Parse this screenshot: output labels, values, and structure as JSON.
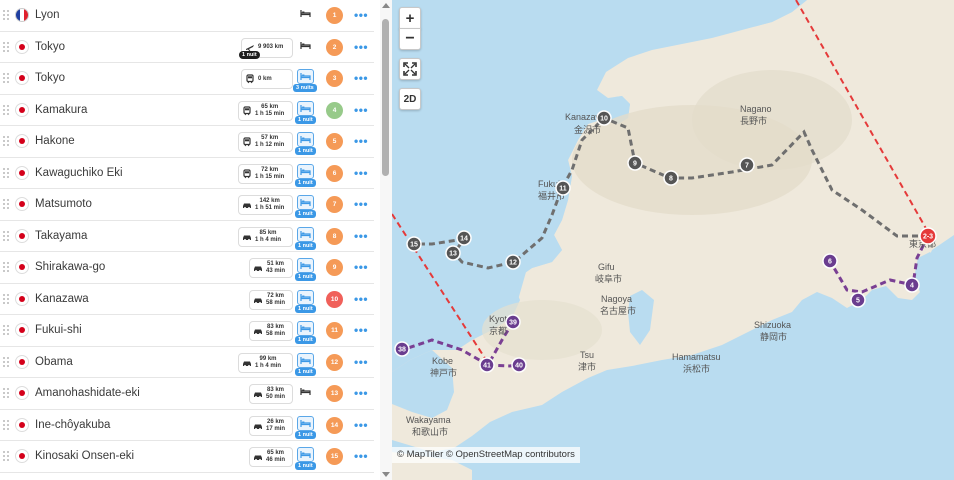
{
  "itinerary": [
    {
      "city": "Lyon",
      "flag": "fr",
      "number": "1",
      "color": "#f59a57",
      "stay": "home"
    },
    {
      "city": "Tokyo",
      "flag": "jp",
      "number": "2",
      "color": "#f59a57",
      "stay": "home",
      "transport": {
        "mode": "plane",
        "distance": "9 903 km",
        "duration": ""
      },
      "transport_badge": "1 nuit"
    },
    {
      "city": "Tokyo",
      "flag": "jp",
      "number": "3",
      "color": "#f59a57",
      "stay": "book",
      "nights": "3 nuits",
      "transport": {
        "mode": "train",
        "distance": "0 km",
        "duration": ""
      }
    },
    {
      "city": "Kamakura",
      "flag": "jp",
      "number": "4",
      "color": "#97ca8a",
      "stay": "book",
      "nights": "1 nuit",
      "transport": {
        "mode": "train",
        "distance": "65 km",
        "duration": "1 h 15 min"
      }
    },
    {
      "city": "Hakone",
      "flag": "jp",
      "number": "5",
      "color": "#f59a57",
      "stay": "book",
      "nights": "1 nuit",
      "transport": {
        "mode": "train",
        "distance": "57 km",
        "duration": "1 h 12 min"
      }
    },
    {
      "city": "Kawaguchiko Eki",
      "flag": "jp",
      "number": "6",
      "color": "#f59a57",
      "stay": "book",
      "nights": "1 nuit",
      "transport": {
        "mode": "train",
        "distance": "72 km",
        "duration": "1 h 15 min"
      }
    },
    {
      "city": "Matsumoto",
      "flag": "jp",
      "number": "7",
      "color": "#f59a57",
      "stay": "book",
      "nights": "1 nuit",
      "transport": {
        "mode": "car",
        "distance": "142 km",
        "duration": "1 h 51 min"
      }
    },
    {
      "city": "Takayama",
      "flag": "jp",
      "number": "8",
      "color": "#f59a57",
      "stay": "book",
      "nights": "1 nuit",
      "transport": {
        "mode": "car",
        "distance": "85 km",
        "duration": "1 h 4 min"
      }
    },
    {
      "city": "Shirakawa-go",
      "flag": "jp",
      "number": "9",
      "color": "#f59a57",
      "stay": "book",
      "nights": "1 nuit",
      "transport": {
        "mode": "car",
        "distance": "51 km",
        "duration": "43 min"
      }
    },
    {
      "city": "Kanazawa",
      "flag": "jp",
      "number": "10",
      "color": "#f0605a",
      "stay": "book",
      "nights": "1 nuit",
      "transport": {
        "mode": "car",
        "distance": "72 km",
        "duration": "58 min"
      }
    },
    {
      "city": "Fukui-shi",
      "flag": "jp",
      "number": "11",
      "color": "#f59a57",
      "stay": "book",
      "nights": "1 nuit",
      "transport": {
        "mode": "car",
        "distance": "83 km",
        "duration": "58 min"
      }
    },
    {
      "city": "Obama",
      "flag": "jp",
      "number": "12",
      "color": "#f59a57",
      "stay": "book",
      "nights": "1 nuit",
      "transport": {
        "mode": "car",
        "distance": "99 km",
        "duration": "1 h 4 min"
      }
    },
    {
      "city": "Amanohashidate-eki",
      "flag": "jp",
      "number": "13",
      "color": "#f59a57",
      "stay": "home",
      "transport": {
        "mode": "car",
        "distance": "83 km",
        "duration": "50 min"
      }
    },
    {
      "city": "Ine-chôyakuba",
      "flag": "jp",
      "number": "14",
      "color": "#f59a57",
      "stay": "book",
      "nights": "1 nuit",
      "transport": {
        "mode": "car",
        "distance": "26 km",
        "duration": "17 min"
      }
    },
    {
      "city": "Kinosaki Onsen-eki",
      "flag": "jp",
      "number": "15",
      "color": "#f59a57",
      "stay": "book",
      "nights": "1 nuit",
      "transport": {
        "mode": "car",
        "distance": "65 km",
        "duration": "46 min"
      }
    }
  ],
  "more_icon": "more-horizontal-icon",
  "map": {
    "zoom_in": "+",
    "zoom_out": "−",
    "fullscreen_icon": "expand-icon",
    "view_toggle": "2D",
    "attribution": "© MapTiler © OpenStreetMap contributors",
    "places": [
      {
        "name": "Kanazawa",
        "jp": "金沢市"
      },
      {
        "name": "Fukui",
        "jp": "福井市"
      },
      {
        "name": "Nagano",
        "jp": "長野市"
      },
      {
        "name": "Gifu",
        "jp": "岐阜市"
      },
      {
        "name": "Nagoya",
        "jp": "名古屋市"
      },
      {
        "name": "Shizuoka",
        "jp": "静岡市"
      },
      {
        "name": "Kyoto",
        "jp": "京都"
      },
      {
        "name": "Kobe",
        "jp": "神戸市"
      },
      {
        "name": "Tsu",
        "jp": "津市"
      },
      {
        "name": "Hamamatsu",
        "jp": "浜松市"
      },
      {
        "name": "Wakayama",
        "jp": "和歌山市"
      },
      {
        "name": "Tokyo",
        "jp": "東京都"
      }
    ],
    "gray_pins": [
      "10",
      "9",
      "8",
      "7",
      "11",
      "15",
      "14",
      "13",
      "12"
    ],
    "purple_pins": [
      "6",
      "5",
      "4",
      "39",
      "38",
      "41",
      "40"
    ],
    "red_pin": "2-3"
  }
}
